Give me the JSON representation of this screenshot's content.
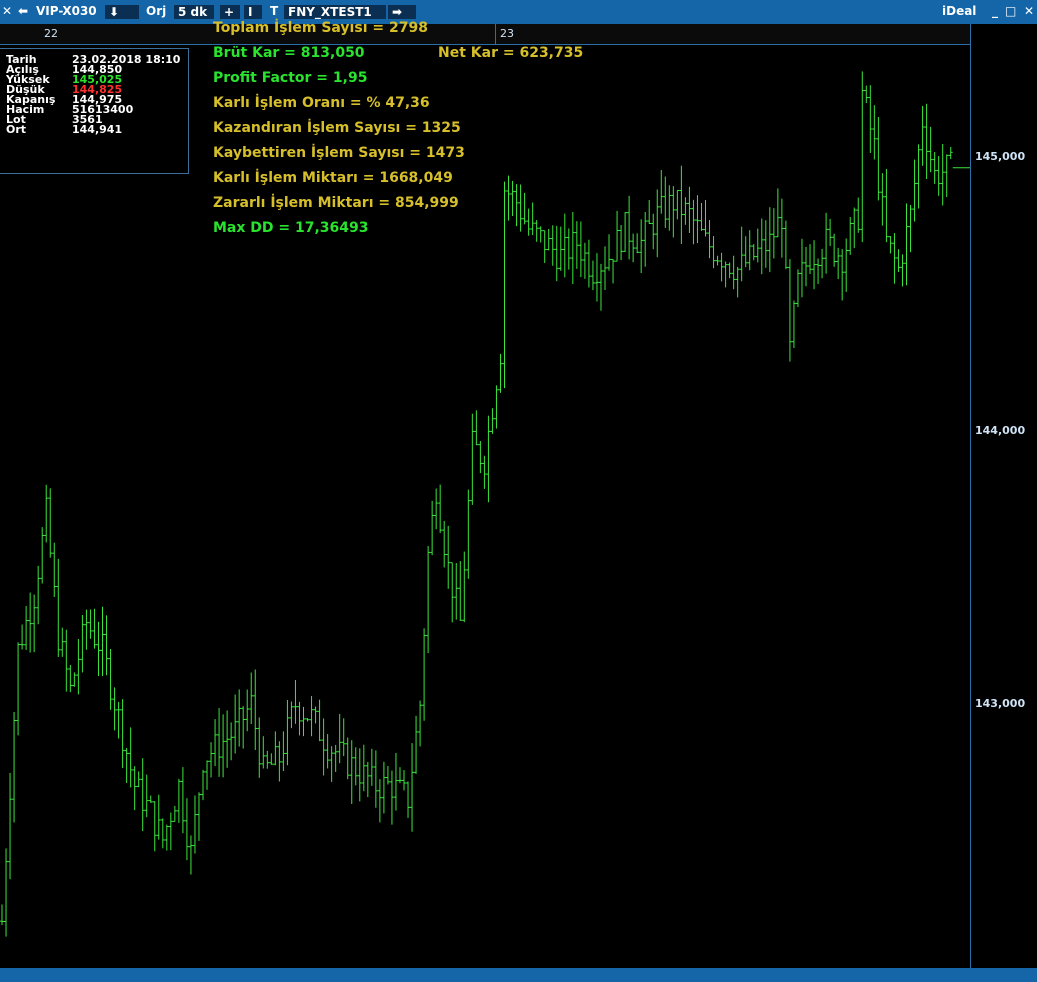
{
  "topbar": {
    "close_glyph": "✕",
    "back_glyph": "⬅",
    "symbol": "VIP-X030",
    "download_glyph": "⬇",
    "mode": "Orj",
    "period": "5 dk",
    "plus_glyph": "+",
    "bar_glyph": "I",
    "t_glyph": "T",
    "system": "FNY_XTEST1",
    "forward_glyph": "➡",
    "brand": "iDeal",
    "minimize_glyph": "_",
    "maximize_glyph": "□",
    "close2_glyph": "✕"
  },
  "datebar": {
    "day1": "22",
    "day2": "23"
  },
  "ohlc": {
    "rows": [
      {
        "key": "Tarih",
        "value": "23.02.2018 18:10"
      },
      {
        "key": "Açılış",
        "value": "144,850"
      },
      {
        "key": "Yüksek",
        "value": "145,025"
      },
      {
        "key": "Düşük",
        "value": "144,825"
      },
      {
        "key": "Kapanış",
        "value": "144,975"
      },
      {
        "key": "Hacim",
        "value": "51613400"
      },
      {
        "key": "Lot",
        "value": "3561"
      },
      {
        "key": "Ort",
        "value": "144,941"
      }
    ],
    "high_color": "#29e32e",
    "low_color": "#ff3030"
  },
  "stats": {
    "toplam": "Toplam İşlem Sayısı =  2798",
    "brut": "Brüt Kar =  813,050",
    "net": "Net Kar =  623,735",
    "pf": "Profit Factor =  1,95",
    "oran": "Karlı İşlem Oranı = % 47,36",
    "kazandiran": "Kazandıran İşlem Sayısı =  1325",
    "kaybettiren": "Kaybettiren İşlem Sayısı =  1473",
    "karli_miktar": "Karlı İşlem Miktarı =  1668,049",
    "zararli_miktar": "Zararlı İşlem Miktarı =  854,999",
    "maxdd": "Max DD = 17,36493"
  },
  "axis": {
    "labels": [
      "145,000",
      "144,000",
      "143,000"
    ]
  },
  "colors": {
    "bars": "#3be63b",
    "yellow": "#d6bf2a",
    "green": "#29e32e",
    "accent": "#1466a8"
  },
  "chart_data": {
    "type": "ohlc",
    "y_ticks": [
      145000,
      144000,
      143000
    ],
    "last_price": 144975,
    "sessions": [
      "22",
      "23"
    ],
    "close_path": [
      {
        "i": 0,
        "v": 142200
      },
      {
        "i": 4,
        "v": 143200
      },
      {
        "i": 8,
        "v": 143400
      },
      {
        "i": 11,
        "v": 143700
      },
      {
        "i": 14,
        "v": 143250
      },
      {
        "i": 17,
        "v": 143050
      },
      {
        "i": 21,
        "v": 143300
      },
      {
        "i": 25,
        "v": 143200
      },
      {
        "i": 29,
        "v": 142950
      },
      {
        "i": 33,
        "v": 142700
      },
      {
        "i": 37,
        "v": 142600
      },
      {
        "i": 40,
        "v": 142500
      },
      {
        "i": 44,
        "v": 142700
      },
      {
        "i": 47,
        "v": 142450
      },
      {
        "i": 50,
        "v": 142800
      },
      {
        "i": 54,
        "v": 142850
      },
      {
        "i": 58,
        "v": 142900
      },
      {
        "i": 62,
        "v": 143000
      },
      {
        "i": 65,
        "v": 142750
      },
      {
        "i": 69,
        "v": 142800
      },
      {
        "i": 73,
        "v": 143000
      },
      {
        "i": 77,
        "v": 142950
      },
      {
        "i": 81,
        "v": 142850
      },
      {
        "i": 85,
        "v": 142800
      },
      {
        "i": 89,
        "v": 142750
      },
      {
        "i": 93,
        "v": 142700
      },
      {
        "i": 97,
        "v": 142700
      },
      {
        "i": 101,
        "v": 142650
      },
      {
        "i": 104,
        "v": 143000
      },
      {
        "i": 106,
        "v": 143550
      },
      {
        "i": 108,
        "v": 143800
      },
      {
        "i": 111,
        "v": 143500
      },
      {
        "i": 114,
        "v": 143300
      },
      {
        "i": 117,
        "v": 143950
      },
      {
        "i": 120,
        "v": 143900
      },
      {
        "i": 122,
        "v": 144100
      },
      {
        "i": 124,
        "v": 144300
      },
      {
        "i": 125,
        "v": 144900
      },
      {
        "i": 128,
        "v": 144850
      },
      {
        "i": 131,
        "v": 144750
      },
      {
        "i": 135,
        "v": 144700
      },
      {
        "i": 139,
        "v": 144650
      },
      {
        "i": 143,
        "v": 144700
      },
      {
        "i": 147,
        "v": 144600
      },
      {
        "i": 151,
        "v": 144650
      },
      {
        "i": 155,
        "v": 144750
      },
      {
        "i": 159,
        "v": 144700
      },
      {
        "i": 163,
        "v": 144800
      },
      {
        "i": 167,
        "v": 144850
      },
      {
        "i": 171,
        "v": 144800
      },
      {
        "i": 175,
        "v": 144700
      },
      {
        "i": 179,
        "v": 144650
      },
      {
        "i": 183,
        "v": 144600
      },
      {
        "i": 187,
        "v": 144650
      },
      {
        "i": 191,
        "v": 144700
      },
      {
        "i": 194,
        "v": 144800
      },
      {
        "i": 196,
        "v": 144300
      },
      {
        "i": 198,
        "v": 144550
      },
      {
        "i": 201,
        "v": 144650
      },
      {
        "i": 205,
        "v": 144700
      },
      {
        "i": 209,
        "v": 144650
      },
      {
        "i": 213,
        "v": 144800
      },
      {
        "i": 214,
        "v": 145250
      },
      {
        "i": 217,
        "v": 145050
      },
      {
        "i": 220,
        "v": 144700
      },
      {
        "i": 223,
        "v": 144600
      },
      {
        "i": 226,
        "v": 144800
      },
      {
        "i": 229,
        "v": 145150
      },
      {
        "i": 232,
        "v": 144950
      },
      {
        "i": 236,
        "v": 144975
      }
    ]
  }
}
